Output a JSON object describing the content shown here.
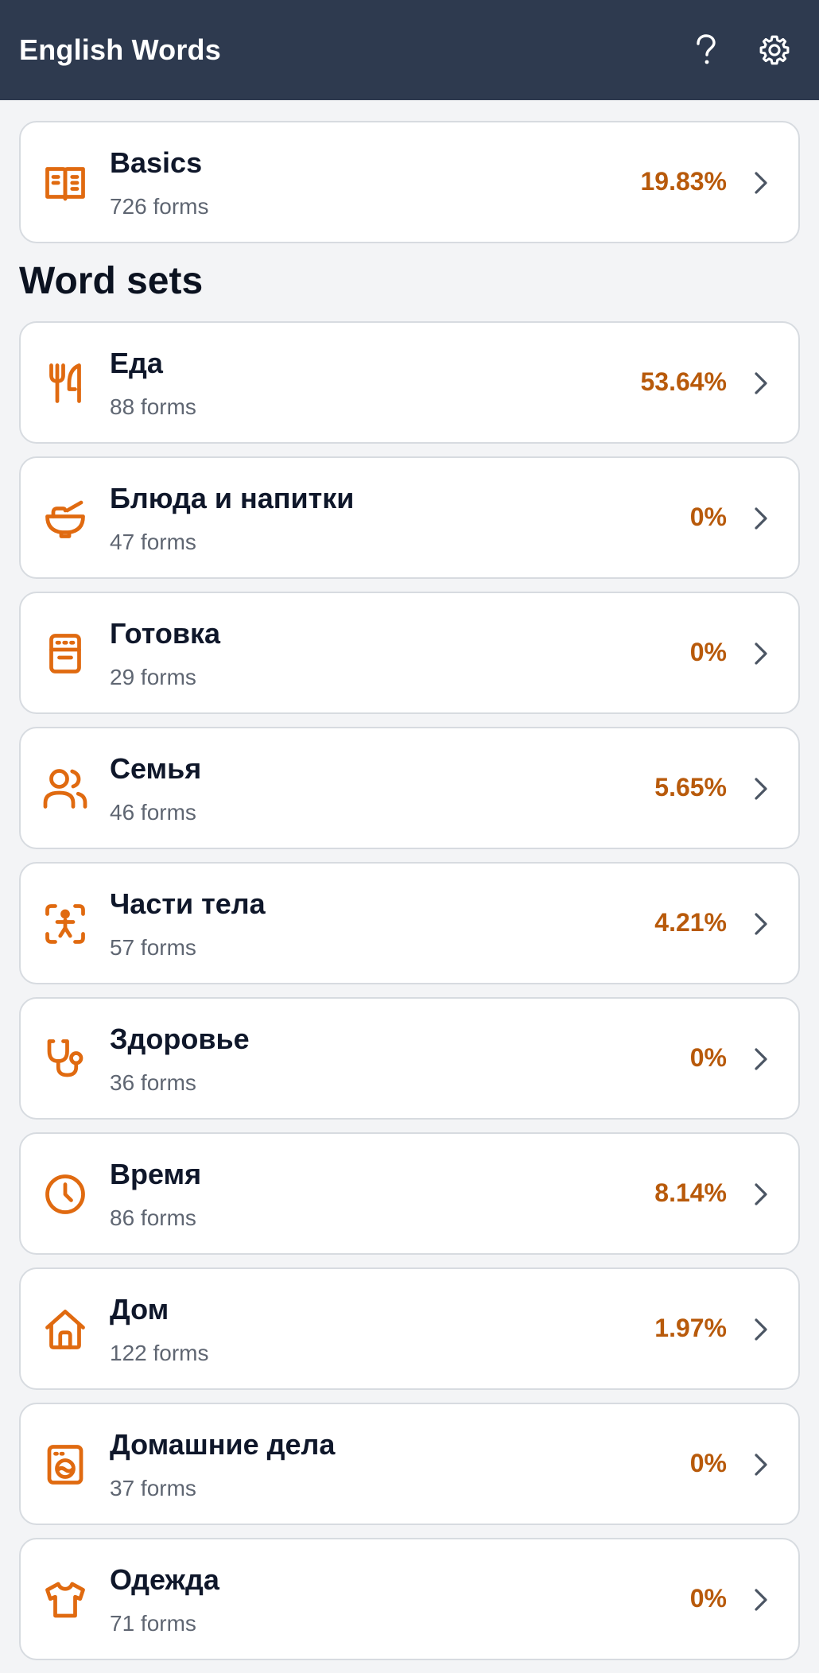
{
  "header": {
    "title": "English Words",
    "help_icon": "help-icon",
    "settings_icon": "gear-icon"
  },
  "colors": {
    "header_bg": "#2e3a4f",
    "accent": "#e06a10",
    "percent": "#b85a0b",
    "page_bg": "#f3f4f6"
  },
  "basics": {
    "title": "Basics",
    "forms": "726 forms",
    "percent": "19.83%",
    "icon": "book-icon"
  },
  "word_sets": {
    "heading": "Word sets",
    "items": [
      {
        "title": "Еда",
        "forms": "88 forms",
        "percent": "53.64%",
        "icon": "utensils-icon"
      },
      {
        "title": "Блюда и напитки",
        "forms": "47 forms",
        "percent": "0%",
        "icon": "bowl-icon"
      },
      {
        "title": "Готовка",
        "forms": "29 forms",
        "percent": "0%",
        "icon": "stove-icon"
      },
      {
        "title": "Семья",
        "forms": "46 forms",
        "percent": "5.65%",
        "icon": "users-icon"
      },
      {
        "title": "Части тела",
        "forms": "57 forms",
        "percent": "4.21%",
        "icon": "body-scan-icon"
      },
      {
        "title": "Здоровье",
        "forms": "36 forms",
        "percent": "0%",
        "icon": "stethoscope-icon"
      },
      {
        "title": "Время",
        "forms": "86 forms",
        "percent": "8.14%",
        "icon": "clock-icon"
      },
      {
        "title": "Дом",
        "forms": "122 forms",
        "percent": "1.97%",
        "icon": "house-icon"
      },
      {
        "title": "Домашние дела",
        "forms": "37 forms",
        "percent": "0%",
        "icon": "washing-machine-icon"
      },
      {
        "title": "Одежда",
        "forms": "71 forms",
        "percent": "0%",
        "icon": "shirt-icon"
      }
    ]
  }
}
